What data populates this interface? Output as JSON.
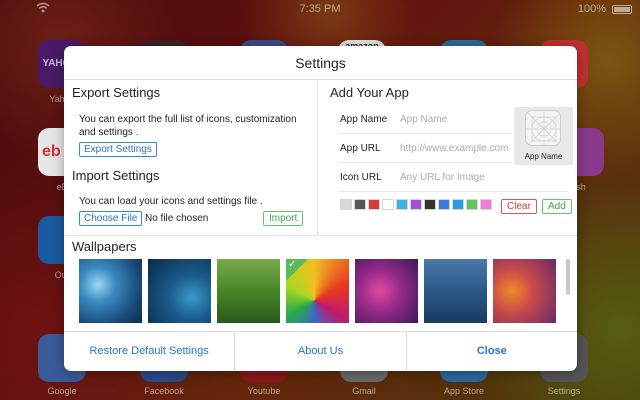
{
  "statusbar": {
    "time": "7:35 PM",
    "battery": "100%"
  },
  "home_apps": {
    "yahoo_tile_text": "YAHOO!",
    "amazon_tile_text": "amazon",
    "ebay_tile_text": "eb",
    "labels": {
      "yahoo": "Yahoo",
      "ebay": "eB",
      "outlook": "Out",
      "sh": "sh",
      "google": "Google",
      "facebook": "Facebook",
      "youtube": "Youtube",
      "gmail": "Gmail",
      "appstore": "App Store",
      "settings": "Settings"
    }
  },
  "modal": {
    "title": "Settings",
    "export": {
      "title": "Export Settings",
      "description": "You can export the full list of icons, customization and settings .",
      "button": "Export Settings"
    },
    "import": {
      "title": "Import Settings",
      "description": "You can load your icons and settings file .",
      "choose_file": "Choose File",
      "file_status": "No file chosen",
      "button": "Import"
    },
    "add_app": {
      "title": "Add Your App",
      "name_label": "App Name",
      "name_placeholder": "App Name",
      "url_label": "App URL",
      "url_placeholder": "http://www.example.com",
      "icon_label": "Icon URL",
      "icon_placeholder": "Any URL for Image",
      "preview_label": "App Name",
      "clear_button": "Clear",
      "add_button": "Add",
      "colors": [
        "#d8d8d8",
        "#555555",
        "#d93a3a",
        "#ffffff",
        "#3ab3e6",
        "#a34fd6",
        "#333333",
        "#3a7ad8",
        "#2a9be0",
        "#5cc85c",
        "#f07bd8"
      ]
    },
    "wallpapers": {
      "title": "Wallpapers",
      "selected_index": 3
    },
    "footer": {
      "restore": "Restore Default Settings",
      "about": "About Us",
      "close": "Close"
    }
  },
  "colors": {
    "accent_blue": "#2a74c8",
    "accent_green": "#3aa444",
    "accent_red": "#d23c3c"
  }
}
